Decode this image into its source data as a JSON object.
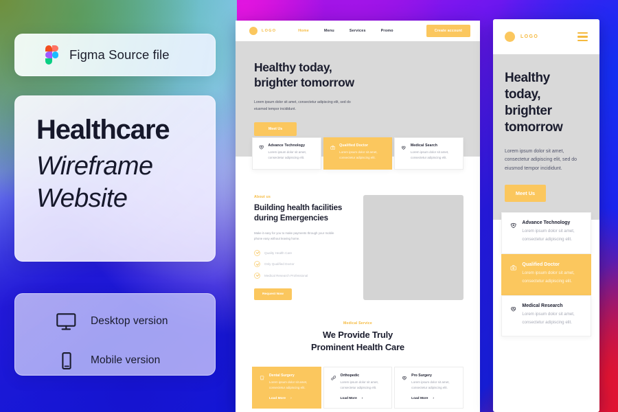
{
  "promo": {
    "figma_badge": {
      "icon": "figma-logo-icon",
      "label": "Figma Source file"
    },
    "title": {
      "line1": "Healthcare",
      "line2": "Wireframe",
      "line3": "Website"
    },
    "versions": [
      {
        "icon": "desktop-monitor-icon",
        "label": "Desktop version"
      },
      {
        "icon": "mobile-phone-icon",
        "label": "Mobile version"
      }
    ]
  },
  "colors": {
    "accent_yellow": "#FBC75E",
    "accent_yellow_text": "#F5B93D",
    "hero_grey": "#D9D9D9",
    "heading_dark": "#1B1D2E",
    "muted_grey": "#9DA0AD"
  },
  "desktop": {
    "nav": {
      "logo_text": "LOGO",
      "links": [
        {
          "label": "Home",
          "active": true
        },
        {
          "label": "Menu",
          "active": false
        },
        {
          "label": "Services",
          "active": false
        },
        {
          "label": "Promo",
          "active": false
        }
      ],
      "cta_label": "Create account"
    },
    "hero": {
      "heading_line1": "Healthy today,",
      "heading_line2": "brighter tomorrow",
      "paragraph": "Lorem ipsum dolor sit amet, consectetur adipiscing elit, sed do eiusmod tempor incididunt.",
      "button_label": "Meet Us"
    },
    "feature_cards": [
      {
        "icon": "tooth-shield-icon",
        "title": "Advance Technology",
        "desc": "Lorem ipsum dolor sit amet, consectetur adipiscing elit.",
        "highlighted": false
      },
      {
        "icon": "doctor-bag-icon",
        "title": "Qualified Doctor",
        "desc": "Lorem ipsum dolor sit amet, consectetur adipiscing elit.",
        "highlighted": true
      },
      {
        "icon": "heart-pulse-icon",
        "title": "Medical Search",
        "desc": "Lorem ipsum dolor sit amet, consectetur adipiscing elit.",
        "highlighted": false
      }
    ],
    "about": {
      "eyebrow": "About us",
      "heading_line1": "Building health facilities",
      "heading_line2": "during Emergencies",
      "paragraph": "Make it easy for you to make payments through your mobile phone easy without leaving home.",
      "checklist": [
        "Quality Health Care",
        "Only Qualified Doctor",
        "Medical Research Professional"
      ],
      "button_label": "Request Now",
      "image_placeholder": "about-image-placeholder"
    },
    "services": {
      "eyebrow": "Medical Service",
      "heading_line1": "We Provide Truly",
      "heading_line2": "Prominent Health Care",
      "cards": [
        {
          "icon": "tooth-icon",
          "title": "Dental Surgery",
          "desc": "Lorem ipsum dolor sit amet, consectetur adipiscing elit.",
          "more_label": "Load More",
          "highlighted": true
        },
        {
          "icon": "bone-icon",
          "title": "Orthopedic",
          "desc": "Lorem ipsum dolor sit amet, consectetur adipiscing elit.",
          "more_label": "Load More",
          "highlighted": false
        },
        {
          "icon": "heart-pulse-icon",
          "title": "Pro Surgery",
          "desc": "Lorem ipsum dolor sit amet, consectetur adipiscing elit.",
          "more_label": "Load More",
          "highlighted": false
        }
      ]
    }
  },
  "mobile": {
    "nav": {
      "logo_text": "LOGO",
      "menu_icon": "hamburger-menu-icon"
    },
    "hero": {
      "heading_line1": "Healthy",
      "heading_line2": "today,",
      "heading_line3": "brighter",
      "heading_line4": "tomorrow",
      "paragraph": "Lorem ipsum dolor sit amet, consectetur adipiscing elit, sed do eiusmod tempor incididunt.",
      "button_label": "Meet Us"
    },
    "feature_cards": [
      {
        "icon": "tooth-shield-icon",
        "title": "Advance Technology",
        "desc": "Lorem ipsum dolor sit amet, consectetur adipiscing elit.",
        "highlighted": false
      },
      {
        "icon": "doctor-bag-icon",
        "title": "Qualified Doctor",
        "desc": "Lorem ipsum dolor sit amet, consectetur adipiscing elit.",
        "highlighted": true
      },
      {
        "icon": "heart-pulse-icon",
        "title": "Medical Research",
        "desc": "Lorem ipsum dolor sit amet, consectetur adipiscing elit.",
        "highlighted": false
      }
    ]
  }
}
